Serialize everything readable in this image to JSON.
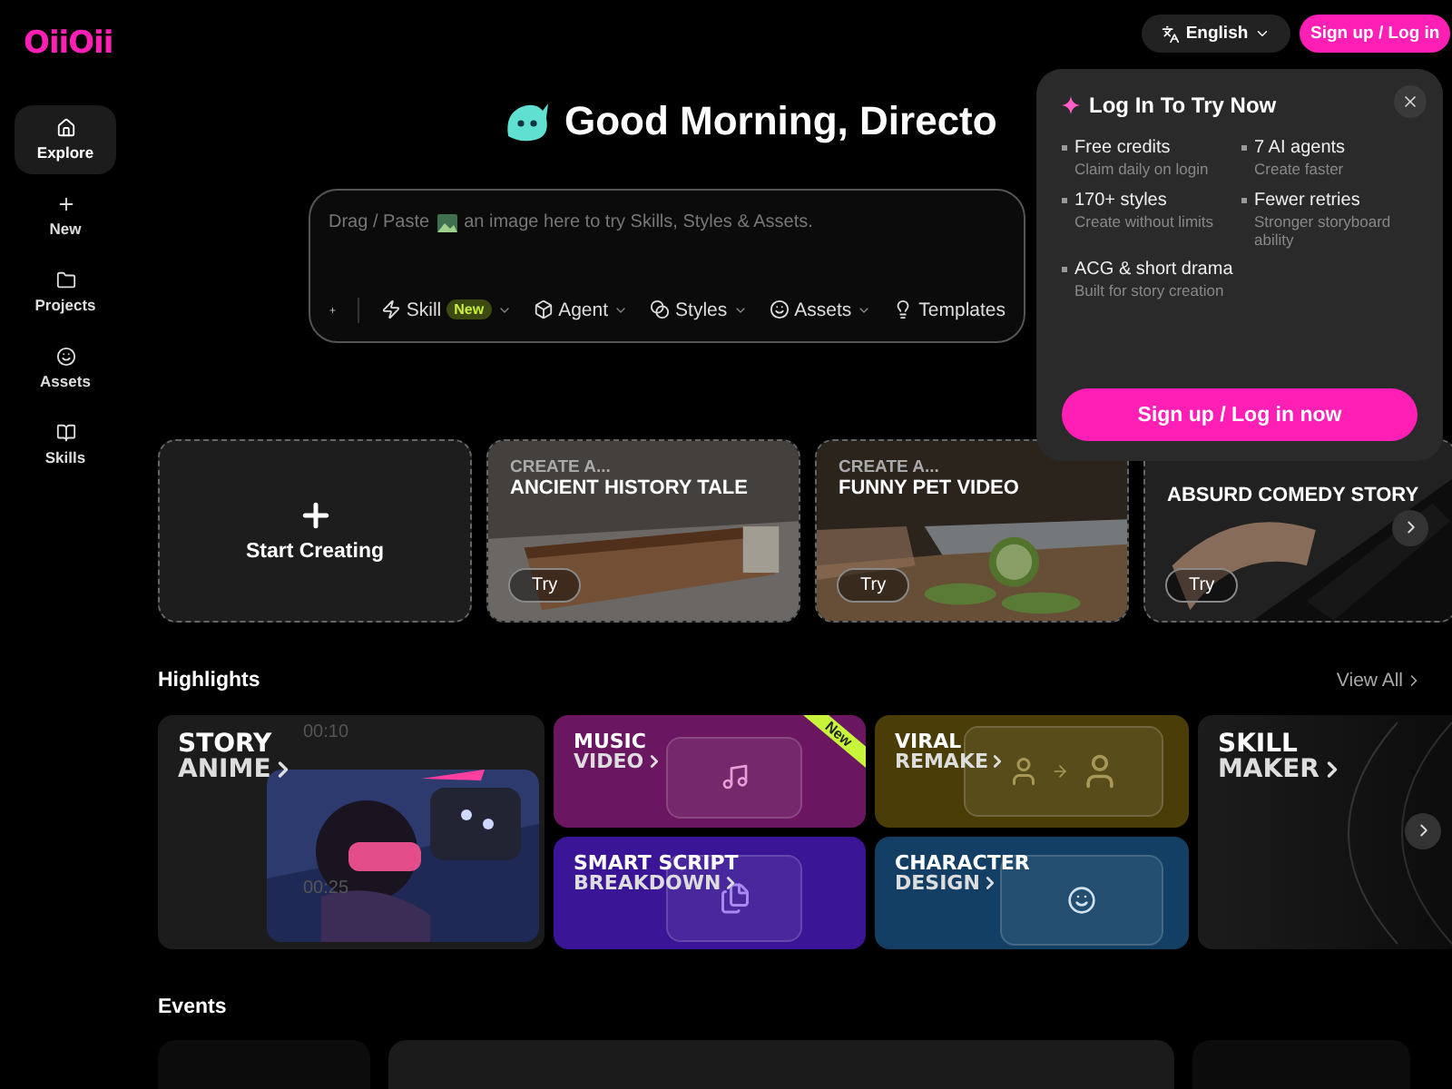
{
  "brand": {
    "logo": "OiiOii"
  },
  "sidebar": {
    "items": [
      {
        "label": "Explore",
        "selected": true
      },
      {
        "label": "New",
        "selected": false
      },
      {
        "label": "Projects",
        "selected": false
      },
      {
        "label": "Assets",
        "selected": false
      },
      {
        "label": "Skills",
        "selected": false
      }
    ]
  },
  "header": {
    "language": "English",
    "signup": "Sign up / Log in"
  },
  "greeting": "Good Morning, Directo",
  "prompt": {
    "hint_before": "Drag / Paste",
    "hint_after": "an image here to try Skills, Styles & Assets.",
    "tools": [
      {
        "label": "Skill",
        "badge": "New",
        "dropdown": true
      },
      {
        "label": "Agent",
        "dropdown": true
      },
      {
        "label": "Styles",
        "dropdown": true
      },
      {
        "label": "Assets",
        "dropdown": true
      },
      {
        "label": "Templates",
        "dropdown": false
      }
    ]
  },
  "create_cards": [
    {
      "kind": "start",
      "label": "Start Creating"
    },
    {
      "kind": "template",
      "eyebrow": "CREATE A...",
      "title": "ANCIENT HISTORY TALE",
      "action": "Try"
    },
    {
      "kind": "template",
      "eyebrow": "CREATE A...",
      "title": "FUNNY PET VIDEO",
      "action": "Try"
    },
    {
      "kind": "template",
      "title": "ABSURD COMEDY STORY",
      "action": "Try"
    }
  ],
  "highlights": {
    "title": "Highlights",
    "view_all": "View All",
    "tiles": [
      {
        "kind": "story",
        "lines": [
          "STORY",
          "ANIME"
        ],
        "times": [
          "00:10",
          "00:25"
        ]
      },
      {
        "kind": "music",
        "lines": [
          "MUSIC",
          "VIDEO"
        ],
        "badge": "New",
        "color": "#6a1660"
      },
      {
        "kind": "viral",
        "lines": [
          "VIRAL",
          "REMAKE"
        ],
        "color": "#4a3d08"
      },
      {
        "kind": "skill",
        "lines": [
          "SKILL",
          "MAKER"
        ]
      },
      {
        "kind": "script",
        "lines": [
          "SMART SCRIPT",
          "BREAKDOWN"
        ],
        "color": "#3a1595"
      },
      {
        "kind": "character",
        "lines": [
          "CHARACTER",
          "DESIGN"
        ],
        "color": "#123f63"
      }
    ]
  },
  "events": {
    "title": "Events"
  },
  "popup": {
    "title": "Log In To Try Now",
    "perks": [
      {
        "title": "Free credits",
        "note": "Claim daily on login"
      },
      {
        "title": "7 AI agents",
        "note": "Create faster"
      },
      {
        "title": "170+ styles",
        "note": "Create without limits"
      },
      {
        "title": "Fewer retries",
        "note": "Stronger storyboard ability"
      },
      {
        "title": "ACG & short drama",
        "note": "Built for story creation"
      }
    ],
    "cta": "Sign up / Log in now"
  }
}
